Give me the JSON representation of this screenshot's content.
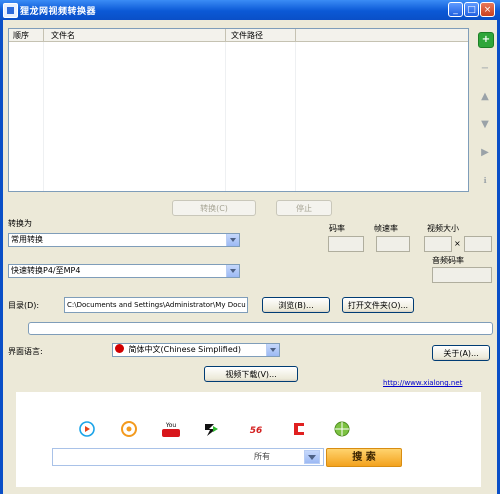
{
  "window": {
    "title": "狸龙网视频转换器"
  },
  "list": {
    "columns": [
      "顺序",
      "文件名",
      "文件路径"
    ]
  },
  "actions": {
    "convert": "转换(C)",
    "stop": "停止"
  },
  "settings": {
    "convert_to_label": "转换为",
    "category_value": "常用转换",
    "format_value": "快速转换P4/至MP4",
    "bitrate_label": "码率",
    "framerate_label": "帧速率",
    "video_size_label": "视频大小",
    "size_separator": "×",
    "audio_bitrate_label": "音频码率"
  },
  "directory": {
    "label": "目录(D):",
    "path": "C:\\Documents and Settings\\Administrator\\My Docu",
    "browse": "浏览(B)...",
    "open_folder": "打开文件夹(O)..."
  },
  "language": {
    "label": "界面语言:",
    "value": "简体中文(Chinese Simplified)",
    "about": "关于(A)..."
  },
  "video_download": "视频下载(V)...",
  "website_link": "http://www.xialong.net",
  "search": {
    "category": "所有",
    "button": "搜 索"
  },
  "site_icons": [
    "youku-icon",
    "tudou-icon",
    "youtube-icon",
    "sina-icon",
    "56-icon",
    "ku6-icon",
    "globe-icon"
  ]
}
